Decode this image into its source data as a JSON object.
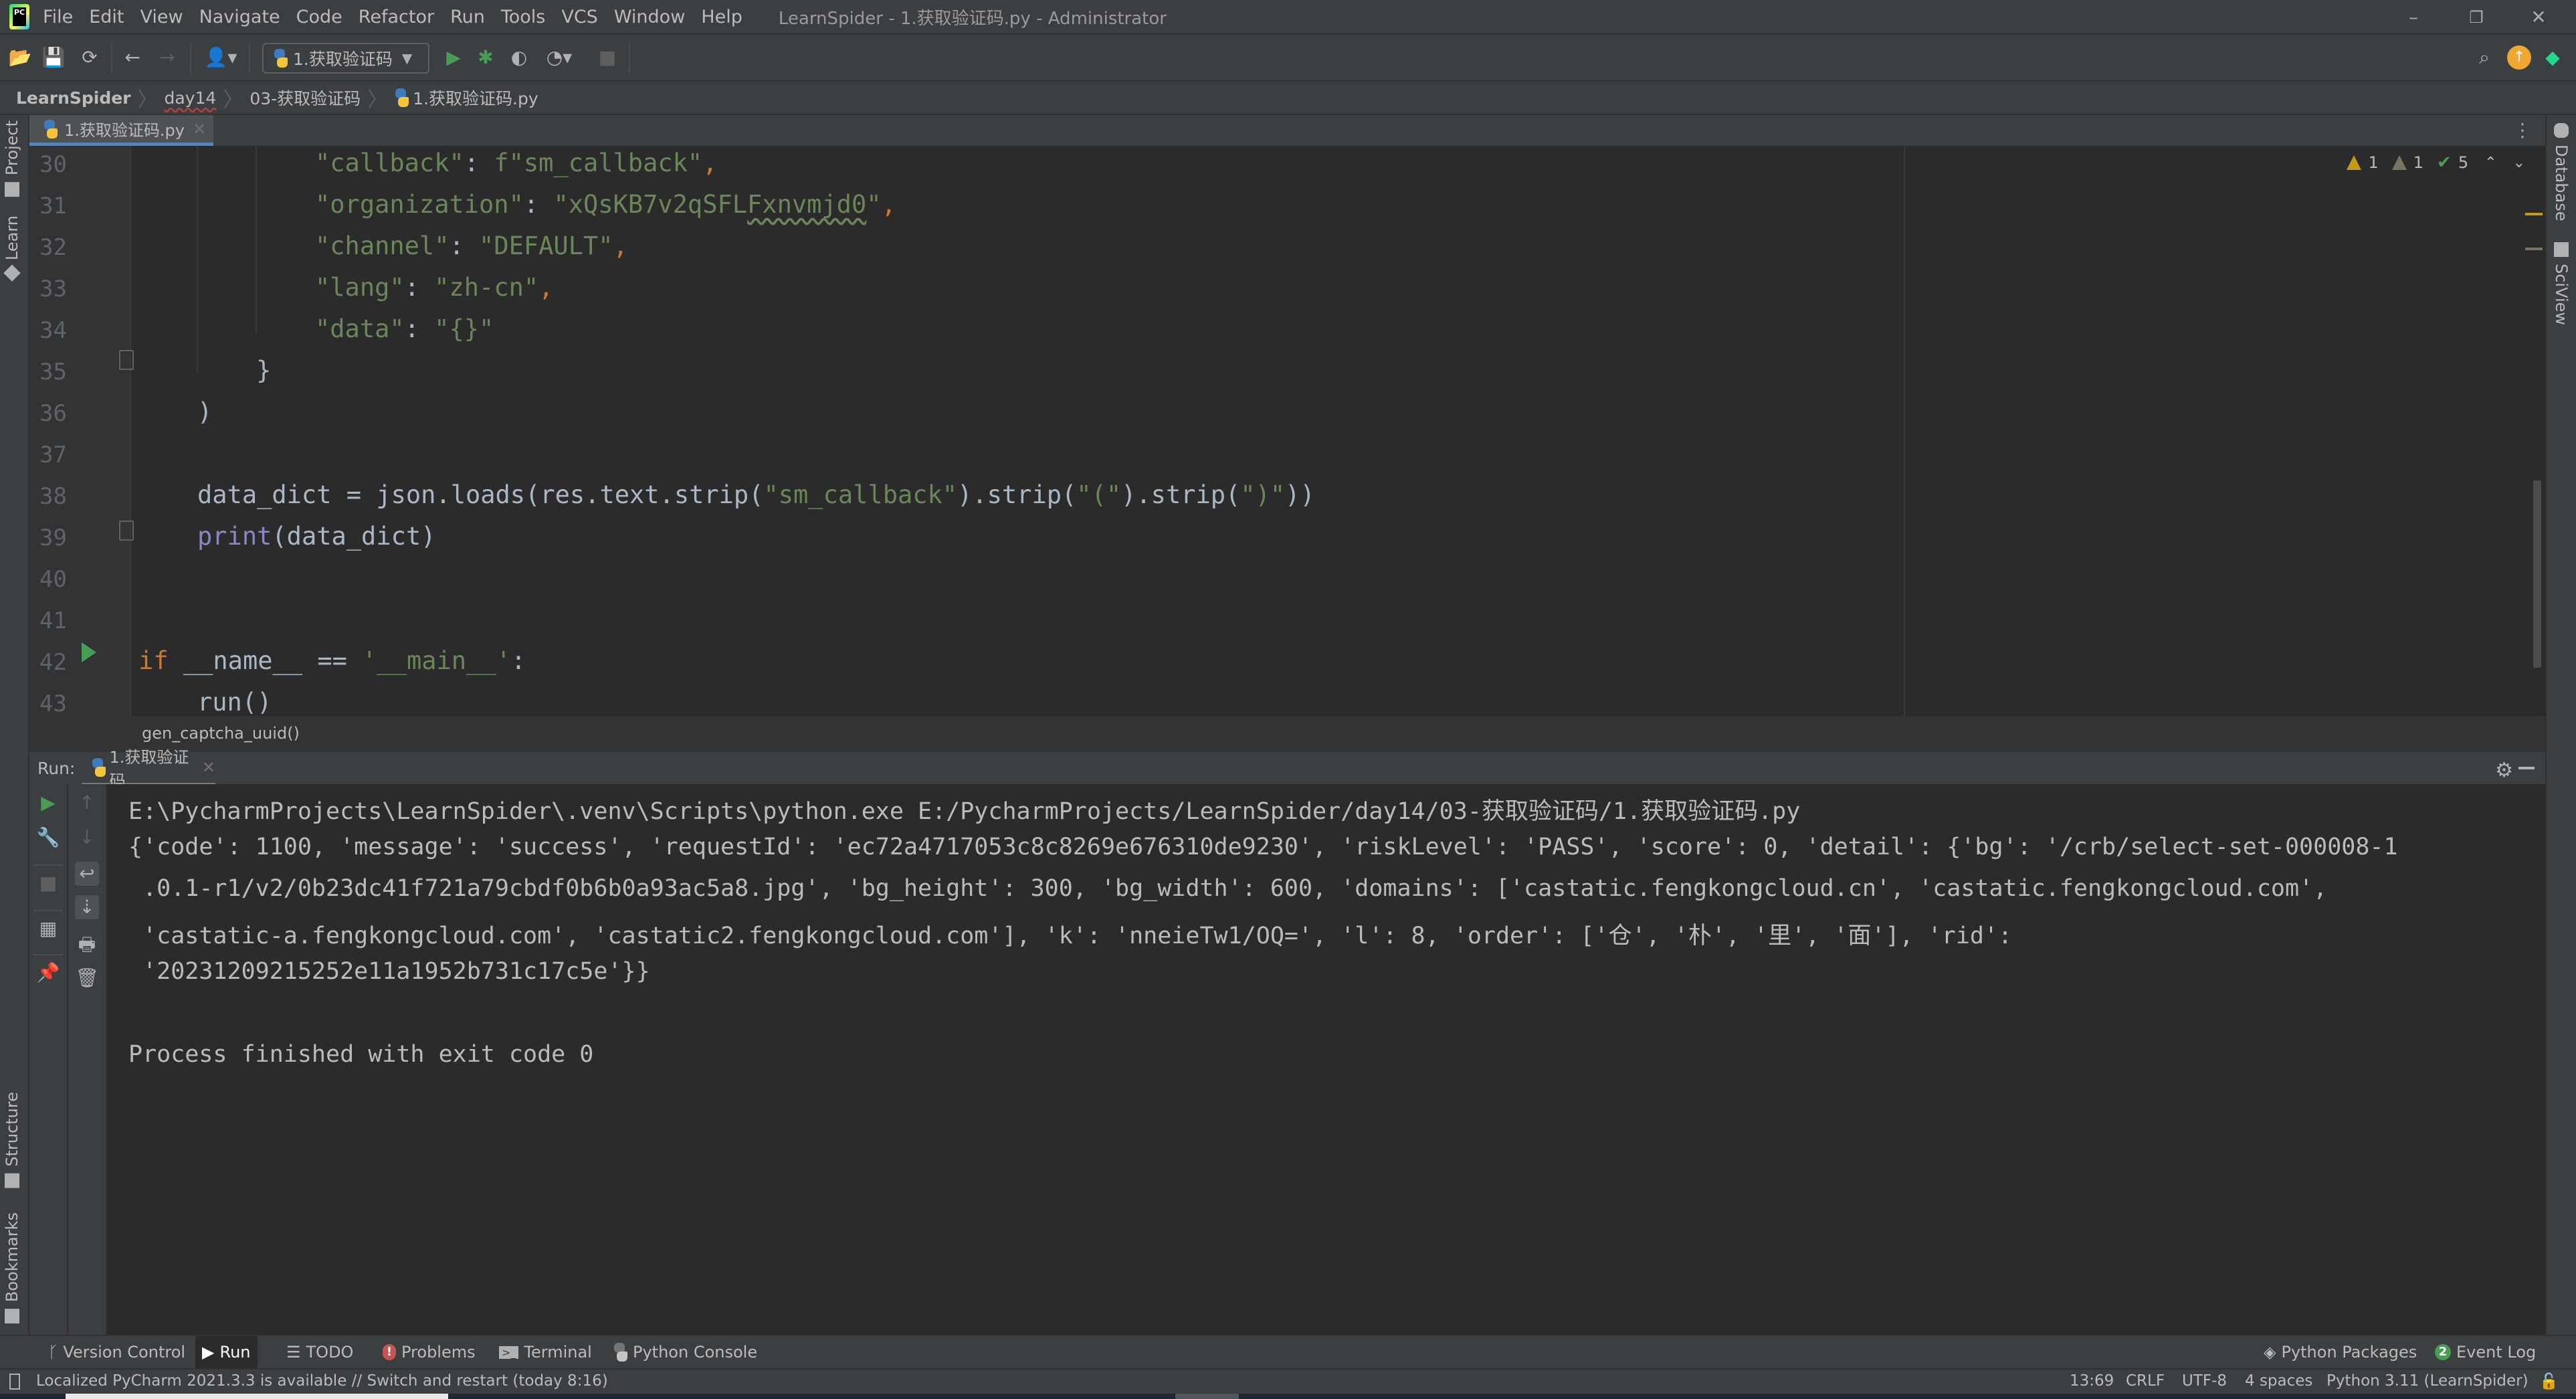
{
  "menubar": {
    "items": [
      "File",
      "Edit",
      "View",
      "Navigate",
      "Code",
      "Refactor",
      "Run",
      "Tools",
      "VCS",
      "Window",
      "Help"
    ],
    "window_title": "LearnSpider - 1.获取验证码.py - Administrator",
    "controls": {
      "minimize": "–",
      "restore": "❐",
      "close": "✕"
    }
  },
  "toolbar": {
    "run_config": "1.获取验证码",
    "icons": [
      "open-icon",
      "save-icon",
      "sync-icon",
      "back-icon",
      "forward-icon",
      "user-icon",
      "run-icon",
      "debug-icon",
      "coverage-icon",
      "profile-icon",
      "stop-icon",
      "search-icon",
      "update-icon",
      "plugin-icon"
    ]
  },
  "breadcrumb": [
    "LearnSpider",
    "day14",
    "03-获取验证码",
    "1.获取验证码.py"
  ],
  "left_strip": {
    "top": [
      "Project",
      "Learn"
    ],
    "bottom": [
      "Structure",
      "Bookmarks"
    ]
  },
  "right_strip": [
    "Database",
    "SciView"
  ],
  "editor": {
    "tab_label": "1.获取验证码.py",
    "inspections": {
      "warnings": "1",
      "weak_warnings": "1",
      "typos": "5"
    },
    "lines": [
      {
        "n": "30",
        "indent": 3,
        "tokens": [
          {
            "t": "\"callback\"",
            "c": "s"
          },
          {
            "t": ": ",
            "c": ""
          },
          {
            "t": "f\"sm_callback\"",
            "c": "s"
          },
          {
            "t": ",",
            "c": "k"
          }
        ]
      },
      {
        "n": "31",
        "indent": 3,
        "tokens": [
          {
            "t": "\"organization\"",
            "c": "s"
          },
          {
            "t": ": ",
            "c": ""
          },
          {
            "t": "\"xQsKB7v2qSFL",
            "c": "s"
          },
          {
            "t": "Fxnvmjd0",
            "c": "s wavy"
          },
          {
            "t": "\"",
            "c": "s"
          },
          {
            "t": ",",
            "c": "k"
          }
        ]
      },
      {
        "n": "32",
        "indent": 3,
        "tokens": [
          {
            "t": "\"channel\"",
            "c": "s"
          },
          {
            "t": ": ",
            "c": ""
          },
          {
            "t": "\"DEFAULT\"",
            "c": "s"
          },
          {
            "t": ",",
            "c": "k"
          }
        ]
      },
      {
        "n": "33",
        "indent": 3,
        "tokens": [
          {
            "t": "\"lang\"",
            "c": "s"
          },
          {
            "t": ": ",
            "c": ""
          },
          {
            "t": "\"zh-cn\"",
            "c": "s"
          },
          {
            "t": ",",
            "c": "k"
          }
        ]
      },
      {
        "n": "34",
        "indent": 3,
        "tokens": [
          {
            "t": "\"data\"",
            "c": "s"
          },
          {
            "t": ": ",
            "c": ""
          },
          {
            "t": "\"{}\"",
            "c": "s"
          }
        ]
      },
      {
        "n": "35",
        "indent": 2,
        "tokens": [
          {
            "t": "}",
            "c": ""
          }
        ]
      },
      {
        "n": "36",
        "indent": 1,
        "tokens": [
          {
            "t": ")",
            "c": ""
          }
        ]
      },
      {
        "n": "37",
        "indent": 0,
        "tokens": []
      },
      {
        "n": "38",
        "indent": 1,
        "tokens": [
          {
            "t": "data_dict = json.loads(res.text.strip(",
            "c": ""
          },
          {
            "t": "\"sm_callback\"",
            "c": "s"
          },
          {
            "t": ").strip(",
            "c": ""
          },
          {
            "t": "\"(\"",
            "c": "s"
          },
          {
            "t": ").strip(",
            "c": ""
          },
          {
            "t": "\")\"",
            "c": "s"
          },
          {
            "t": "))",
            "c": ""
          }
        ]
      },
      {
        "n": "39",
        "indent": 1,
        "tokens": [
          {
            "t": "print",
            "c": "b"
          },
          {
            "t": "(data_dict)",
            "c": ""
          }
        ]
      },
      {
        "n": "40",
        "indent": 0,
        "tokens": []
      },
      {
        "n": "41",
        "indent": 0,
        "tokens": []
      },
      {
        "n": "42",
        "indent": 0,
        "tokens": [
          {
            "t": "if",
            "c": "k"
          },
          {
            "t": " __name__ == ",
            "c": ""
          },
          {
            "t": "'__main__'",
            "c": "s"
          },
          {
            "t": ":",
            "c": ""
          }
        ]
      },
      {
        "n": "43",
        "indent": 1,
        "tokens": [
          {
            "t": "run()",
            "c": ""
          }
        ]
      }
    ]
  },
  "function_breadcrumb": "gen_captcha_uuid()",
  "run_panel": {
    "label": "Run:",
    "tab_label": "1.获取验证码",
    "console_lines": [
      "E:\\PycharmProjects\\LearnSpider\\.venv\\Scripts\\python.exe E:/PycharmProjects/LearnSpider/day14/03-获取验证码/1.获取验证码.py",
      "{'code': 1100, 'message': 'success', 'requestId': 'ec72a4717053c8c8269e676310de9230', 'riskLevel': 'PASS', 'score': 0, 'detail': {'bg': '/crb/select-set-000008-1",
      " .0.1-r1/v2/0b23dc41f721a79cbdf0b6b0a93ac5a8.jpg', 'bg_height': 300, 'bg_width': 600, 'domains': ['castatic.fengkongcloud.cn', 'castatic.fengkongcloud.com',",
      " 'castatic-a.fengkongcloud.com', 'castatic2.fengkongcloud.com'], 'k': 'nneieTw1/OQ=', 'l': 8, 'order': ['仓', '朴', '里', '面'], 'rid':",
      " '20231209215252e11a1952b731c17c5e'}}",
      "",
      "Process finished with exit code 0"
    ]
  },
  "toolwindows": {
    "left": [
      {
        "label": "Version Control",
        "icon": "branch-icon"
      },
      {
        "label": "Run",
        "icon": "run-icon",
        "active": true
      },
      {
        "label": "TODO",
        "icon": "list-icon"
      },
      {
        "label": "Problems",
        "icon": "error-icon"
      },
      {
        "label": "Terminal",
        "icon": "terminal-icon"
      },
      {
        "label": "Python Console",
        "icon": "python-icon"
      }
    ],
    "right": [
      {
        "label": "Python Packages",
        "icon": "layers-icon"
      },
      {
        "label": "Event Log",
        "badge": "2"
      }
    ]
  },
  "statusbar": {
    "message": "Localized PyCharm 2021.3.3 is available // Switch and restart (today 8:16)",
    "position": "13:69",
    "line_sep": "CRLF",
    "encoding": "UTF-8",
    "indent": "4 spaces",
    "interpreter": "Python 3.11 (LearnSpider)"
  },
  "colors": {
    "accent": "#4a88c7",
    "string": "#6a8759",
    "keyword": "#cc7832",
    "builtin": "#8888c6",
    "run_green": "#499c54",
    "warning": "#c29a15"
  }
}
